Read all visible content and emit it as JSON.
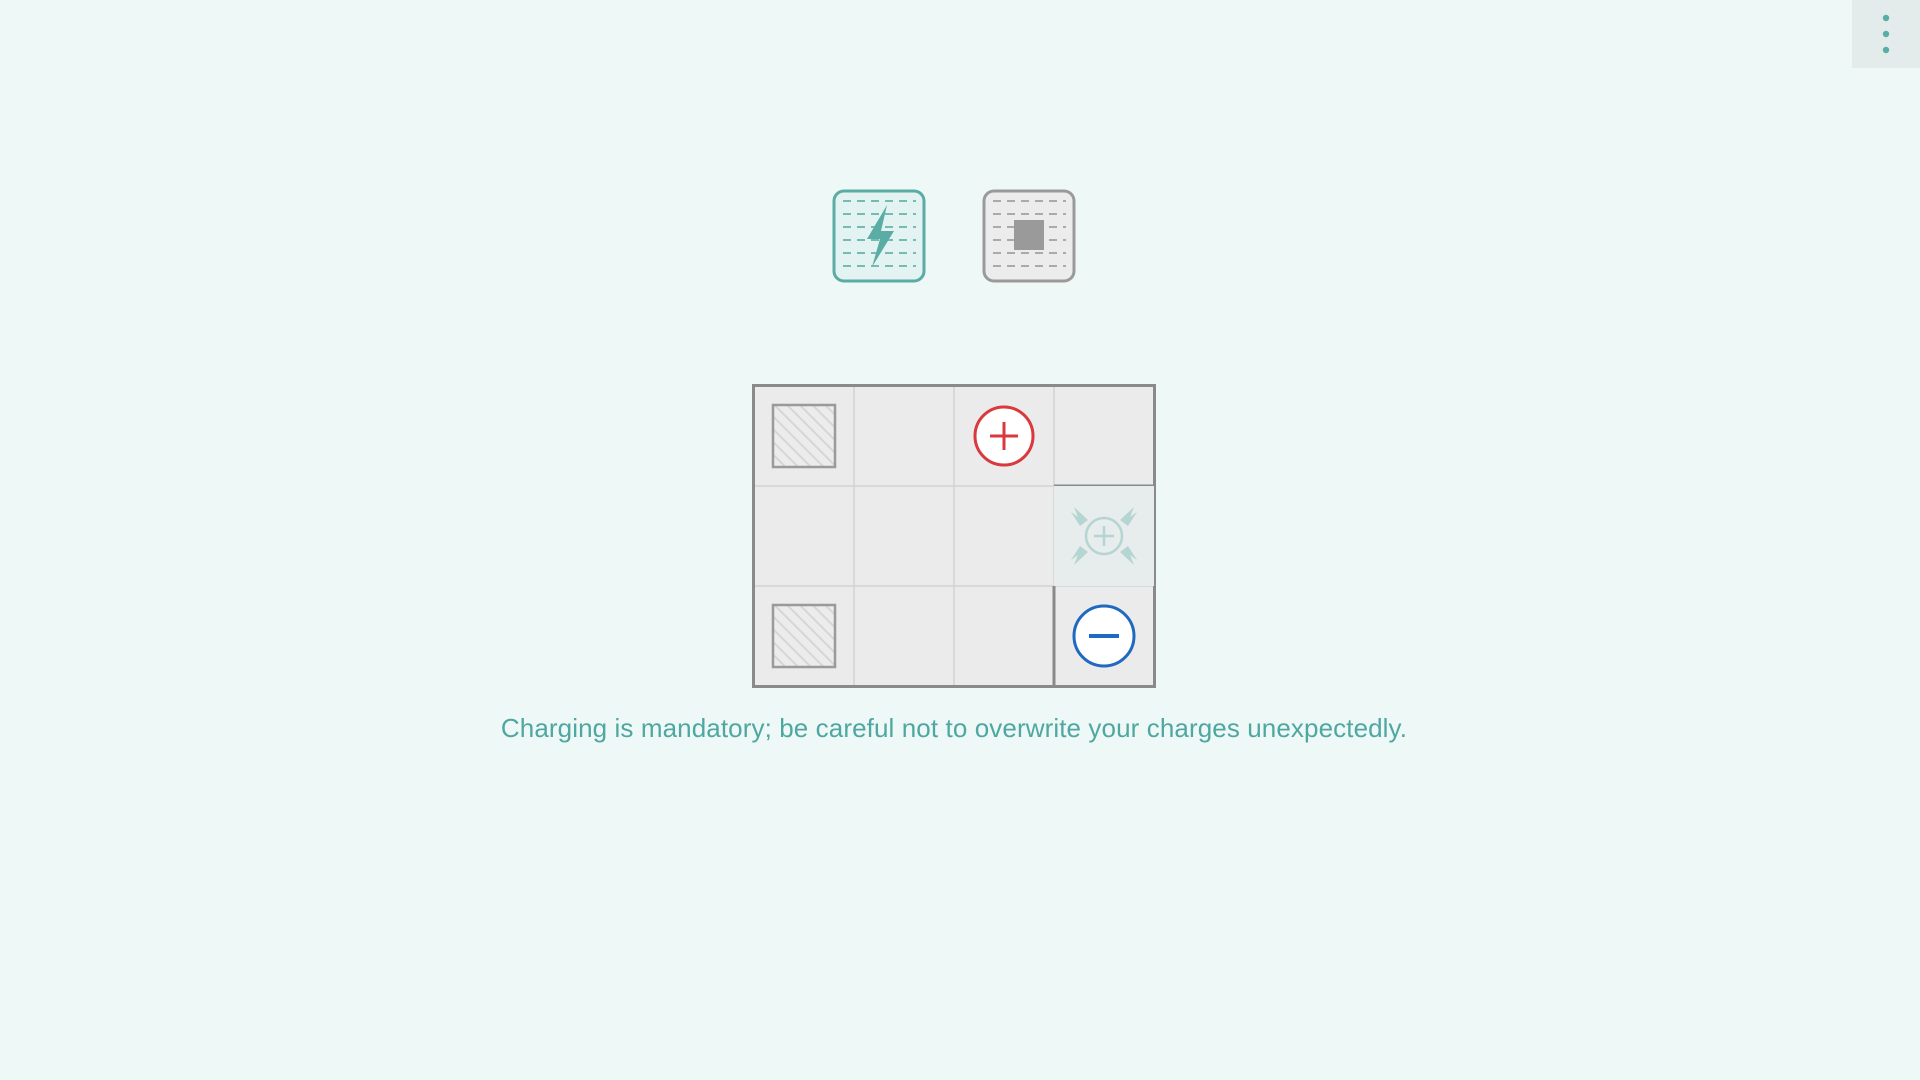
{
  "colors": {
    "background": "#eef8f7",
    "accent": "#5aaca5",
    "grid_line": "#d2d2d2",
    "board_border": "#8a8a8a",
    "cell_fill": "#ebebeb",
    "plus_red": "#d9393c",
    "minus_blue": "#1f69c1",
    "neutral_gray": "#9a9a9a"
  },
  "menu": {
    "icon": "vertical-dots-icon"
  },
  "tools": [
    {
      "name": "tool-charge",
      "icon": "lightning-bolt-icon",
      "selected": true
    },
    {
      "name": "tool-block",
      "icon": "solid-square-icon",
      "selected": false
    }
  ],
  "board": {
    "rows": 3,
    "cols": 4,
    "cells": [
      [
        "block",
        "empty",
        "plus",
        "empty"
      ],
      [
        "empty",
        "empty",
        "empty",
        "charge-field"
      ],
      [
        "block",
        "empty",
        "empty",
        "minus"
      ]
    ],
    "walls": [
      "below r0c3",
      "left of r2c3"
    ]
  },
  "hint": "Charging is mandatory; be careful not to overwrite your charges unexpectedly."
}
